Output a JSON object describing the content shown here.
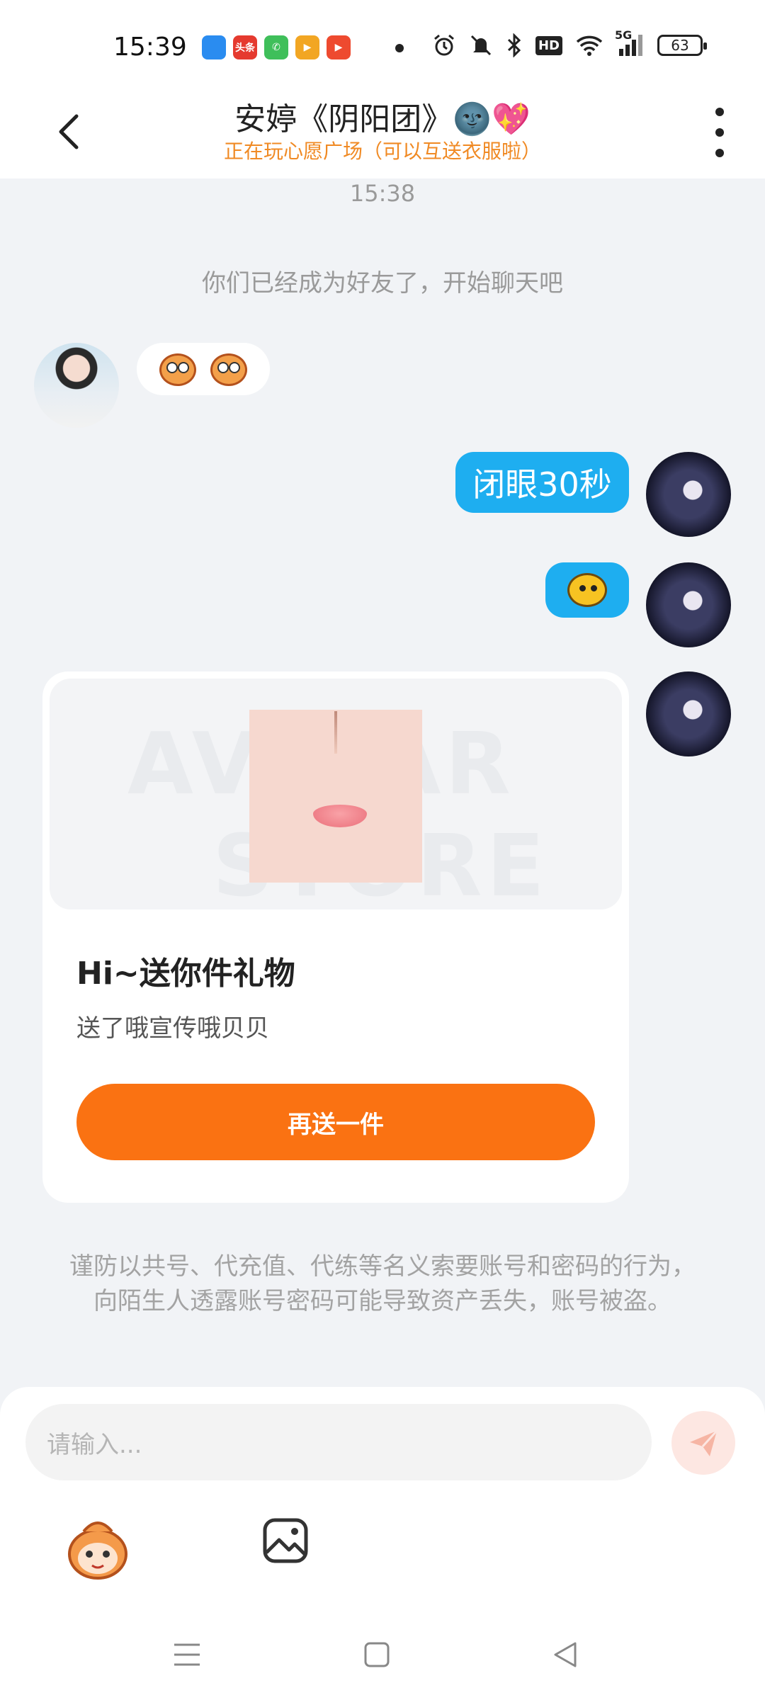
{
  "status_bar": {
    "time": "15:39",
    "app_icons": [
      {
        "name": "browser-icon",
        "color": "#2a8cf0",
        "label": ""
      },
      {
        "name": "toutiao-icon",
        "color": "#e53a2f",
        "label": "头条"
      },
      {
        "name": "phone-app-icon",
        "color": "#3fbf5a",
        "label": ""
      },
      {
        "name": "video-app-icon",
        "color": "#f2a623",
        "label": ""
      },
      {
        "name": "play-app-icon",
        "color": "#ee4a2f",
        "label": ""
      }
    ],
    "network": "5G",
    "hd_label": "HD",
    "battery": "63"
  },
  "header": {
    "title": "安婷《阴阳团》🌚💖",
    "subtitle": "正在玩心愿广场（可以互送衣服啦）"
  },
  "chat": {
    "timestamp": "15:38",
    "system_message": "你们已经成为好友了，开始聊天吧",
    "sent_text": "闭眼30秒"
  },
  "gift_card": {
    "watermark": "AVATAR",
    "watermark2": "STORE",
    "title": "Hi~送你件礼物",
    "description": "送了哦宣传哦贝贝",
    "button_label": "再送一件"
  },
  "warning": "谨防以共号、代充值、代练等名义索要账号和密码的行为，向陌生人透露账号密码可能导致资产丢失，账号被盗。",
  "input": {
    "placeholder": "请输入..."
  },
  "colors": {
    "accent_orange": "#fa7212",
    "bubble_blue": "#1eaef0",
    "subtitle_orange": "#f08a24"
  }
}
